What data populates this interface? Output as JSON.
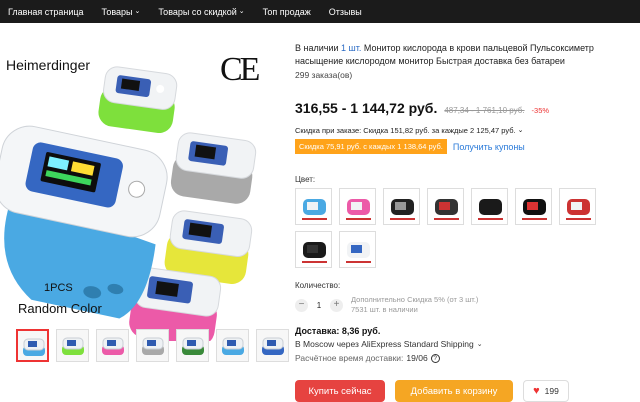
{
  "nav": {
    "items": [
      {
        "label": "Главная страница",
        "dropdown": false
      },
      {
        "label": "Товары",
        "dropdown": true
      },
      {
        "label": "Товары со скидкой",
        "dropdown": true
      },
      {
        "label": "Топ продаж",
        "dropdown": false
      },
      {
        "label": "Отзывы",
        "dropdown": false
      }
    ],
    "dropdown_icon": "chevron-down-icon"
  },
  "gallery": {
    "brand_text": "Heimerdinger",
    "ce_mark": "CE",
    "pcs_text": "1PCS",
    "random_color_text": "Random Color",
    "device_colors": [
      "#7ee03c",
      "#a9a9a9",
      "#e6e63a",
      "#ec5aa8",
      "#4aa9e3"
    ],
    "thumbnail_count": 7,
    "active_thumbnail": 0
  },
  "product": {
    "title_prefix": "В наличии ",
    "title_qty": "1 шт.",
    "title_rest": " Монитор кислорода в крови пальцевой Пульсоксиметр насыщение кислородом монитор Быстрая доставка без батареи",
    "orders": "299 заказа(ов)"
  },
  "price": {
    "current": "316,55 - 1 144,72 руб.",
    "old": "487,34 - 1 761,10 руб.",
    "discount": "-35%"
  },
  "promo": {
    "store_discount": "Скидка при заказе: Скидка 151,82 руб. за каждые 2 125,47 руб.",
    "coupon_tag": "Скидка 75,91 руб. с каждых 1 138,64 руб.",
    "coupon_link": "Получить купоны"
  },
  "colors": {
    "label": "Цвет:",
    "options": [
      {
        "name": "multi-pack"
      },
      {
        "name": "color-set"
      },
      {
        "name": "pouch-pack"
      },
      {
        "name": "gray-case-pack"
      },
      {
        "name": "black-device"
      },
      {
        "name": "black-red-screen"
      },
      {
        "name": "device-with-case"
      },
      {
        "name": "black-device-plus"
      },
      {
        "name": "white-device-plus"
      }
    ]
  },
  "quantity": {
    "label": "Количество:",
    "value": "1",
    "extra_discount": "Дополнительно Скидка 5% (от 3 шт.)",
    "stock": "7531 шт. в наличии"
  },
  "shipping": {
    "title": "Доставка: 8,36 руб.",
    "via": "В Moscow через AliExpress Standard Shipping",
    "time_label": "Расчётное время доставки:",
    "time_date": "19/06",
    "help_icon": "question-circle-icon"
  },
  "actions": {
    "buy_now": "Купить сейчас",
    "add_to_cart": "Добавить в корзину",
    "wishlist_count": "199",
    "wishlist_icon": "heart-icon"
  }
}
